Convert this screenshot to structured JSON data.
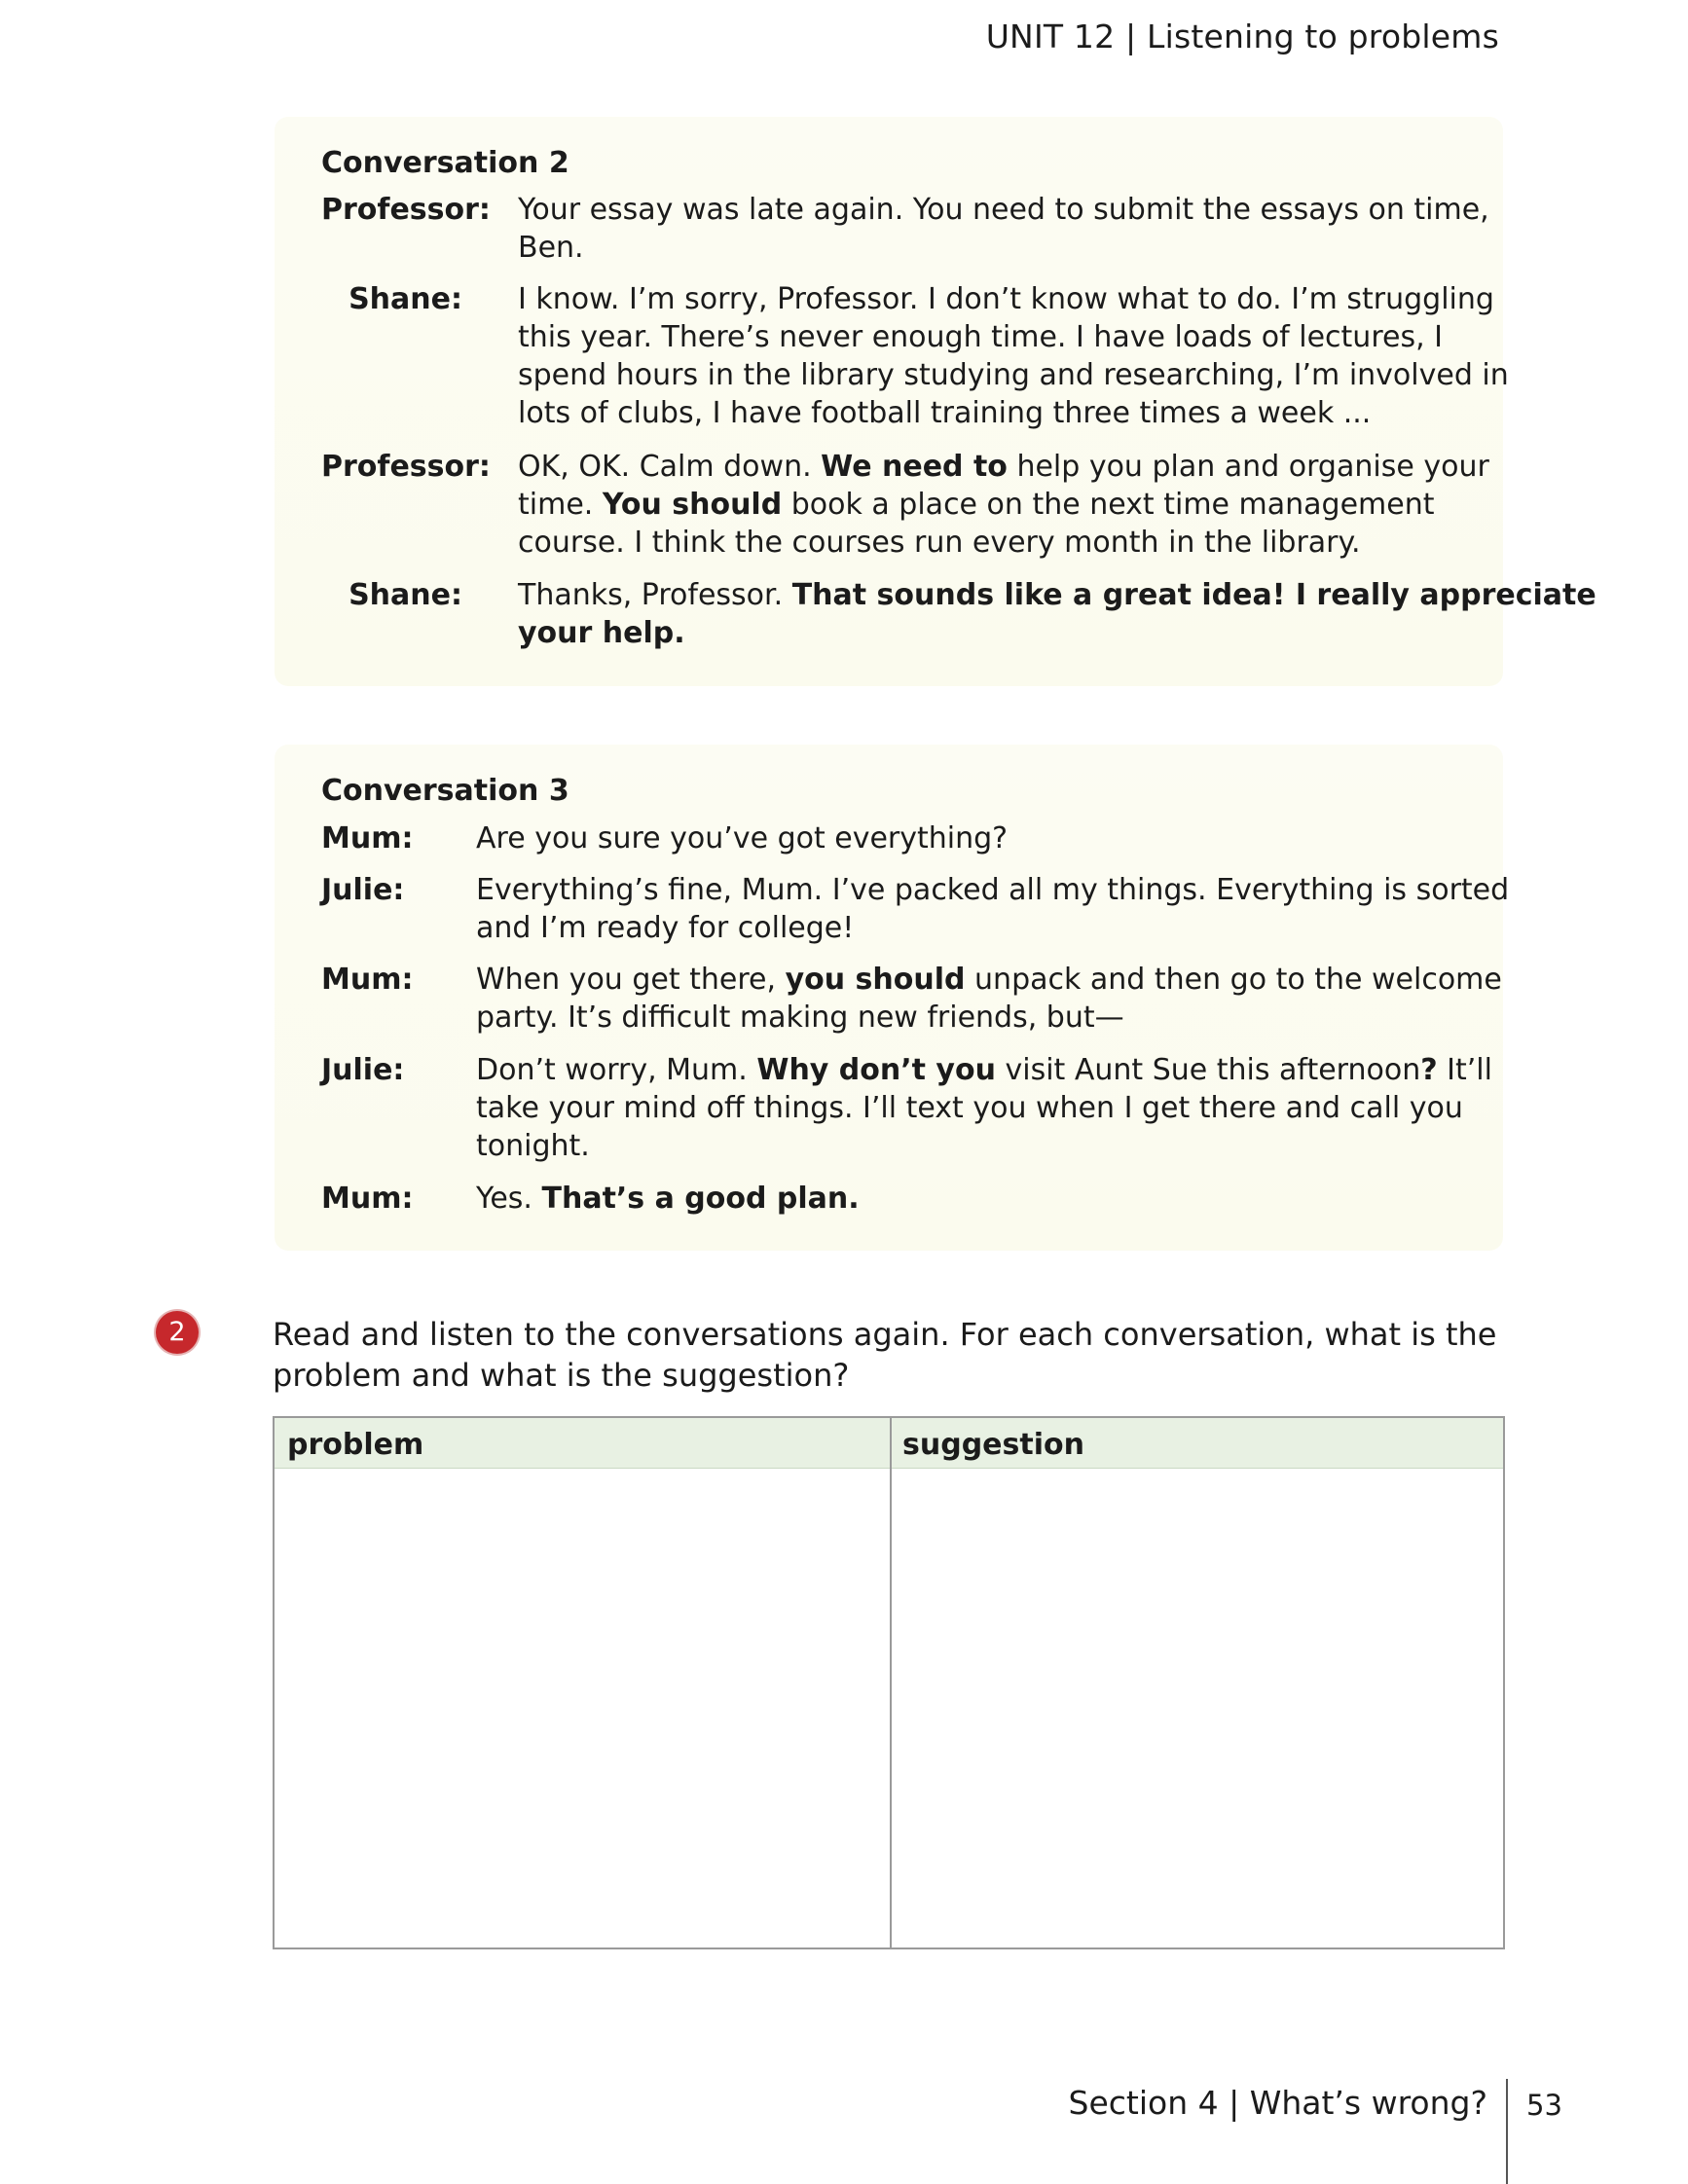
{
  "header": {
    "unit": "UNIT 12 | Listening to problems"
  },
  "conversation2": {
    "title": "Conversation 2",
    "lines": [
      {
        "speaker": "Professor:",
        "html": "Your essay was late again. You need to submit the essays on time,<br>Ben."
      },
      {
        "speaker": "Shane:",
        "html": "I know. I’m sorry, Professor. I don’t know what to do. I’m struggling<br>this year. There’s never enough time. I have loads of lectures, I<br>spend hours in the library studying and researching, I’m involved in<br>lots of clubs, I have football training three times a week ..."
      },
      {
        "speaker": "Professor:",
        "html": "OK, OK. Calm down. <b>We need to</b> help you plan and organise your<br>time. <b>You should</b> book a place on the next time management<br>course. I think the courses run every month in the library."
      },
      {
        "speaker": "Shane:",
        "html": "Thanks, Professor. <b>That sounds like a great idea! I really appreciate<br>your help.</b>"
      }
    ]
  },
  "conversation3": {
    "title": "Conversation 3",
    "lines": [
      {
        "speaker": "Mum:",
        "html": "Are you sure you’ve got everything?"
      },
      {
        "speaker": "Julie:",
        "html": "Everything’s fine, Mum. I’ve packed all my things. Everything is sorted<br>and I’m ready for college!"
      },
      {
        "speaker": "Mum:",
        "html": "When you get there, <b>you should</b> unpack and then go to the welcome<br>party. It’s difficult making new friends, but—"
      },
      {
        "speaker": "Julie:",
        "html": "Don’t worry, Mum. <b>Why don’t you</b> visit Aunt Sue this afternoon<b>?</b> It’ll<br>take your mind off things. I’ll text you when I get there and call you<br>tonight."
      },
      {
        "speaker": "Mum:",
        "html": "Yes. <b>That’s a good plan.</b>"
      }
    ]
  },
  "exercise": {
    "number": "2",
    "instruction": "Read and listen to the conversations again. For each conversation, what is the problem and what is the suggestion?",
    "table": {
      "col1": "problem",
      "col2": "suggestion"
    }
  },
  "footer": {
    "section": "Section 4 | What’s wrong?",
    "page": "53"
  }
}
